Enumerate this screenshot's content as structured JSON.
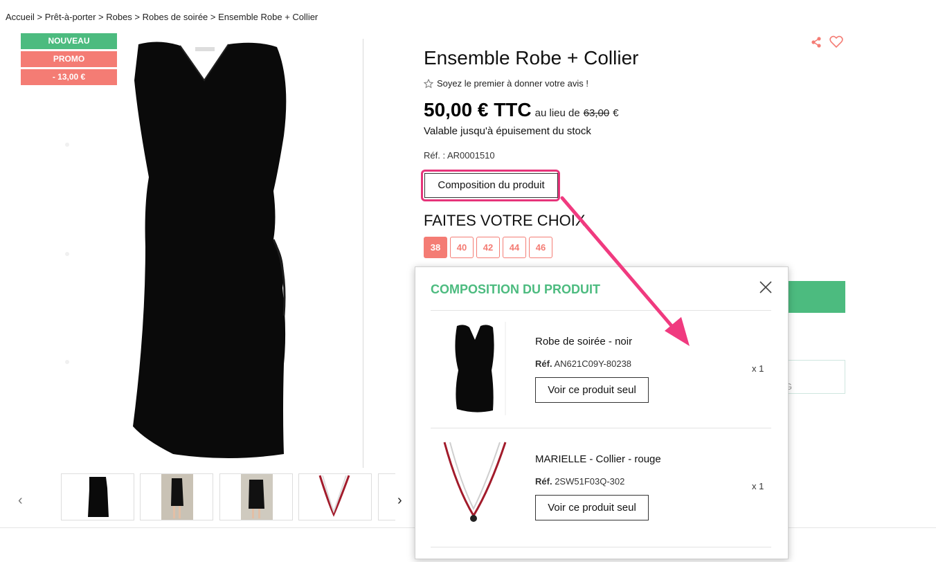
{
  "breadcrumb": "Accueil > Prêt-à-porter > Robes > Robes de soirée > Ensemble Robe + Collier",
  "badges": {
    "new": "NOUVEAU",
    "promo": "PROMO",
    "discount": "- 13,00 €"
  },
  "product": {
    "title": "Ensemble Robe + Collier",
    "review_prompt": "Soyez le premier à donner votre avis !",
    "price": "50,00 € TTC",
    "instead_of": "au lieu de",
    "old_price": "63,00",
    "currency": "€",
    "stock_note": "Valable jusqu'à épuisement du stock",
    "ref": "Réf. : AR0001510",
    "composition_button": "Composition du produit",
    "choice_heading": "FAITES VOTRE CHOIX",
    "sizes": [
      "38",
      "40",
      "42",
      "44",
      "46"
    ],
    "selected_size": "38"
  },
  "popup": {
    "title": "COMPOSITION DU PRODUIT",
    "items": [
      {
        "name": "Robe de soirée - noir",
        "ref_label": "Réf.",
        "ref": "AN621C09Y-80238",
        "button": "Voir ce produit seul",
        "qty": "x 1"
      },
      {
        "name": "MARIELLE - Collier - rouge",
        "ref_label": "Réf.",
        "ref": "2SW51F03Q-302",
        "button": "Voir ce produit seul",
        "qty": "x 1"
      }
    ]
  },
  "behind_popup_glyph": "G",
  "colors": {
    "green": "#4cbb7f",
    "coral": "#f47c74",
    "highlight": "#e6347a"
  },
  "icons": [
    "share-icon",
    "heart-icon",
    "star-icon",
    "close-icon",
    "chevron-left-icon",
    "chevron-right-icon",
    "arrow-annotation"
  ]
}
